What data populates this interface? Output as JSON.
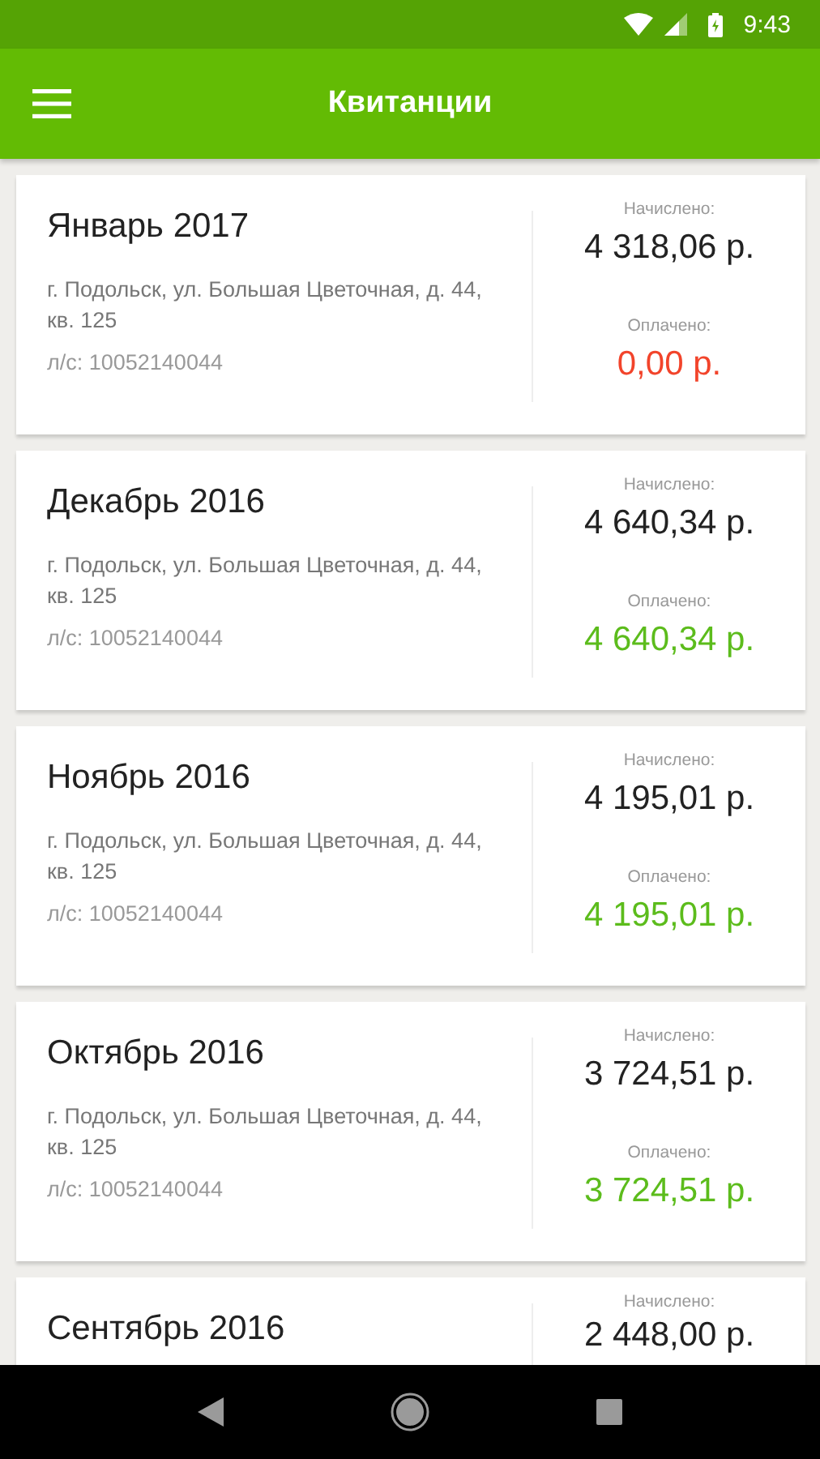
{
  "status_bar": {
    "time": "9:43"
  },
  "app_bar": {
    "title": "Квитанции"
  },
  "receipts": [
    {
      "period": "Январь 2017",
      "address": "г. Подольск, ул. Большая Цветочная, д. 44, кв. 125",
      "account": "л/с: 10052140044",
      "charged_label": "Начислено:",
      "charged": "4 318,06 р.",
      "paid_label": "Оплачено:",
      "paid_amount": "0,00 р.",
      "paid": false
    },
    {
      "period": "Декабрь 2016",
      "address": "г. Подольск, ул. Большая Цветочная, д. 44, кв. 125",
      "account": "л/с: 10052140044",
      "charged_label": "Начислено:",
      "charged": "4 640,34 р.",
      "paid_label": "Оплачено:",
      "paid_amount": "4 640,34 р.",
      "paid": true
    },
    {
      "period": "Ноябрь 2016",
      "address": "г. Подольск, ул. Большая Цветочная, д. 44, кв. 125",
      "account": "л/с: 10052140044",
      "charged_label": "Начислено:",
      "charged": "4 195,01 р.",
      "paid_label": "Оплачено:",
      "paid_amount": "4 195,01 р.",
      "paid": true
    },
    {
      "period": "Октябрь 2016",
      "address": "г. Подольск, ул. Большая Цветочная, д. 44, кв. 125",
      "account": "л/с: 10052140044",
      "charged_label": "Начислено:",
      "charged": "3 724,51 р.",
      "paid_label": "Оплачено:",
      "paid_amount": "3 724,51 р.",
      "paid": true
    },
    {
      "period": "Сентябрь 2016",
      "charged_label": "Начислено:",
      "charged": "2 448,00 р."
    }
  ]
}
